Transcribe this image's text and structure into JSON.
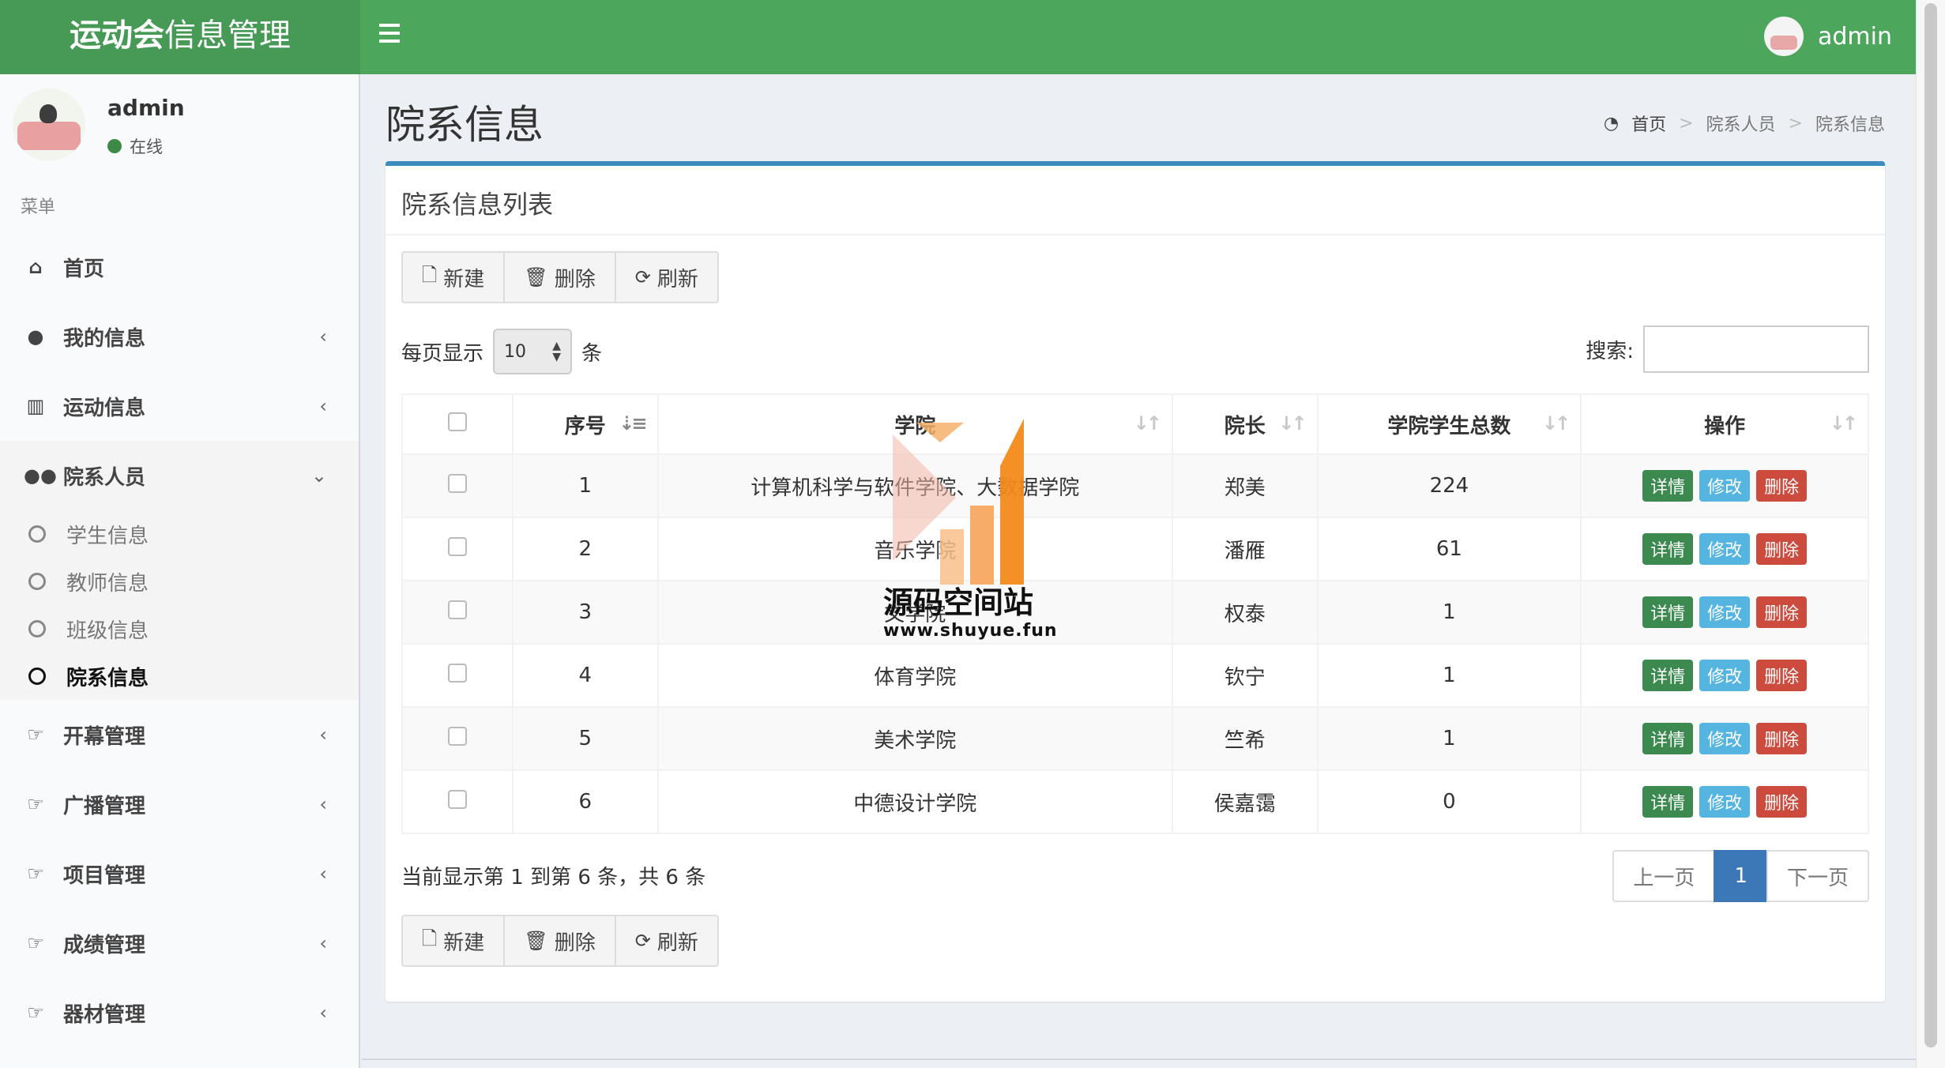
{
  "header": {
    "logo_bold": "运动会",
    "logo_rest": "信息管理",
    "username": "admin"
  },
  "sidebar": {
    "username": "admin",
    "status": "在线",
    "menu_header": "菜单",
    "items": [
      {
        "label": "首页",
        "icon": "home-icon"
      },
      {
        "label": "我的信息",
        "icon": "user-icon"
      },
      {
        "label": "运动信息",
        "icon": "bar-chart-icon"
      },
      {
        "label": "院系人员",
        "icon": "users-icon"
      },
      {
        "label": "开幕管理",
        "icon": "thumbs-up-icon"
      },
      {
        "label": "广播管理",
        "icon": "thumbs-up-icon"
      },
      {
        "label": "项目管理",
        "icon": "thumbs-up-icon"
      },
      {
        "label": "成绩管理",
        "icon": "thumbs-up-icon"
      },
      {
        "label": "器材管理",
        "icon": "thumbs-up-icon"
      }
    ],
    "subitems": [
      "学生信息",
      "教师信息",
      "班级信息",
      "院系信息"
    ]
  },
  "page": {
    "title": "院系信息",
    "breadcrumb": [
      "首页",
      "院系人员",
      "院系信息"
    ]
  },
  "box": {
    "title": "院系信息列表",
    "toolbar": {
      "new": "新建",
      "delete": "删除",
      "refresh": "刷新"
    },
    "length_label_before": "每页显示",
    "length_value": "10",
    "length_label_after": "条",
    "search_label": "搜索:",
    "columns": [
      "序号",
      "学院",
      "院长",
      "学院学生总数",
      "操作"
    ],
    "rows": [
      {
        "no": "1",
        "college": "计算机科学与软件学院、大数据学院",
        "dean": "郑美",
        "total": "224"
      },
      {
        "no": "2",
        "college": "音乐学院",
        "dean": "潘雁",
        "total": "61"
      },
      {
        "no": "3",
        "college": "文学院",
        "dean": "权泰",
        "total": "1"
      },
      {
        "no": "4",
        "college": "体育学院",
        "dean": "钦宁",
        "total": "1"
      },
      {
        "no": "5",
        "college": "美术学院",
        "dean": "竺希",
        "total": "1"
      },
      {
        "no": "6",
        "college": "中德设计学院",
        "dean": "侯嘉霭",
        "total": "0"
      }
    ],
    "actions": {
      "detail": "详情",
      "edit": "修改",
      "delete": "删除"
    },
    "info": "当前显示第 1 到第 6 条，共 6 条",
    "pager": {
      "prev": "上一页",
      "current": "1",
      "next": "下一页"
    }
  },
  "watermark": {
    "text": "源码空间站",
    "url": "www.shuyue.fun"
  },
  "colors": {
    "header": "#4ca65c",
    "primary": "#3c8dbc",
    "detail": "#3c8a4f",
    "edit": "#55b4e0",
    "delete": "#cc4b3d"
  }
}
